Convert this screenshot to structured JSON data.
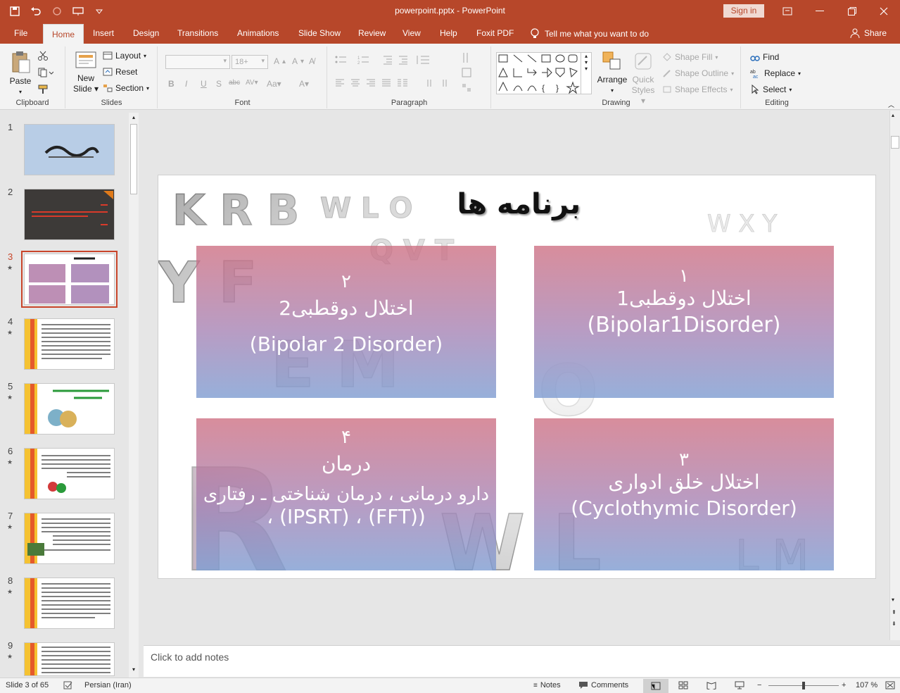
{
  "window": {
    "title": "powerpoint.pptx - PowerPoint",
    "signin": "Sign in"
  },
  "tabs": [
    "File",
    "Home",
    "Insert",
    "Design",
    "Transitions",
    "Animations",
    "Slide Show",
    "Review",
    "View",
    "Help",
    "Foxit PDF"
  ],
  "tell_me": "Tell me what you want to do",
  "share": "Share",
  "ribbon": {
    "clipboard": {
      "label": "Clipboard",
      "paste": "Paste"
    },
    "slides": {
      "label": "Slides",
      "new_slide_1": "New",
      "new_slide_2": "Slide",
      "layout": "Layout",
      "reset": "Reset",
      "section": "Section"
    },
    "font": {
      "label": "Font",
      "size": "18+"
    },
    "paragraph": {
      "label": "Paragraph"
    },
    "drawing": {
      "label": "Drawing",
      "arrange": "Arrange",
      "quick_styles_1": "Quick",
      "quick_styles_2": "Styles",
      "shape_fill": "Shape Fill",
      "shape_outline": "Shape Outline",
      "shape_effects": "Shape Effects"
    },
    "editing": {
      "label": "Editing",
      "find": "Find",
      "replace": "Replace",
      "select": "Select"
    }
  },
  "thumbnails": [
    {
      "num": "1",
      "star": ""
    },
    {
      "num": "2",
      "star": ""
    },
    {
      "num": "3",
      "star": "★"
    },
    {
      "num": "4",
      "star": "★"
    },
    {
      "num": "5",
      "star": "★"
    },
    {
      "num": "6",
      "star": "★"
    },
    {
      "num": "7",
      "star": "★"
    },
    {
      "num": "8",
      "star": "★"
    },
    {
      "num": "9",
      "star": "★"
    }
  ],
  "slide": {
    "title": "برنامه ها",
    "box1": {
      "num": "١",
      "line1": "اختلال دوقطبی1",
      "line2": "(Bipolar1Disorder)"
    },
    "box2": {
      "num": "٢",
      "line1": "اختلال دوقطبی2",
      "line2": "(Bipolar 2 Disorder)"
    },
    "box3": {
      "num": "٣",
      "line1": "اختلال خلق ادواری",
      "line2": "(Cyclothymic Disorder)"
    },
    "box4": {
      "num": "۴",
      "line1": "درمان",
      "line2": "دارو درمانی ، درمان شناختی ـ رفتاری",
      "line3": "،  (IPSRT) ، (FFT))"
    }
  },
  "notes_placeholder": "Click to add notes",
  "status": {
    "slide": "Slide 3 of 65",
    "language": "Persian (Iran)",
    "notes": "Notes",
    "comments": "Comments",
    "zoom": "107 %"
  },
  "colors": {
    "accent": "#b7472a",
    "box_top": "#cd6d80",
    "box_bottom": "#809ed2"
  }
}
